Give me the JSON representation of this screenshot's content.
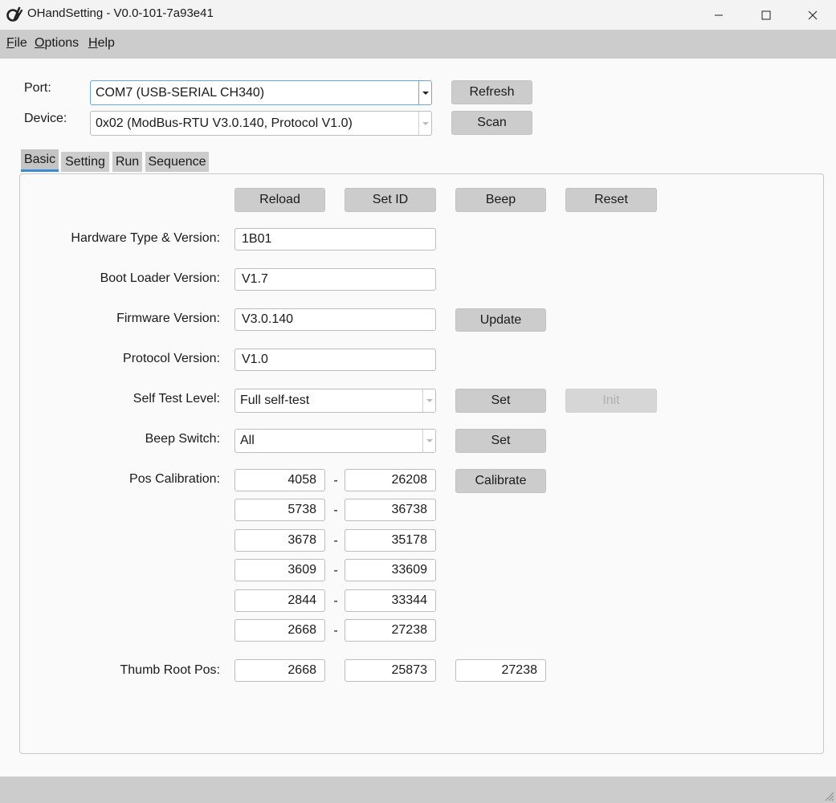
{
  "window": {
    "title": "OHandSetting - V0.0-101-7a93e41",
    "icon": "ohand-logo-icon"
  },
  "menu": [
    {
      "mnemonic": "F",
      "rest": "ile"
    },
    {
      "mnemonic": "O",
      "rest": "ptions"
    },
    {
      "mnemonic": "H",
      "rest": "elp"
    }
  ],
  "connection": {
    "port_label": "Port:",
    "port_value": "COM7 (USB-SERIAL CH340)",
    "device_label": "Device:",
    "device_value": "0x02 (ModBus-RTU V3.0.140, Protocol V1.0)",
    "refresh_label": "Refresh",
    "scan_label": "Scan"
  },
  "tabs": [
    "Basic",
    "Setting",
    "Run",
    "Sequence"
  ],
  "basic": {
    "actions": [
      "Reload",
      "Set ID",
      "Beep",
      "Reset"
    ],
    "hardware_label": "Hardware Type & Version:",
    "hardware_value": "1B01",
    "bootloader_label": "Boot Loader Version:",
    "bootloader_value": "V1.7",
    "firmware_label": "Firmware Version:",
    "firmware_value": "V3.0.140",
    "update_label": "Update",
    "protocol_label": "Protocol Version:",
    "protocol_value": "V1.0",
    "selftest_label": "Self Test Level:",
    "selftest_value": "Full self-test",
    "selftest_set_label": "Set",
    "init_label": "Init",
    "beep_switch_label": "Beep Switch:",
    "beep_switch_value": "All",
    "beep_set_label": "Set",
    "pos_cal_label": "Pos Calibration:",
    "calibrate_label": "Calibrate",
    "pos_cal": [
      {
        "min": "4058",
        "max": "26208"
      },
      {
        "min": "5738",
        "max": "36738"
      },
      {
        "min": "3678",
        "max": "35178"
      },
      {
        "min": "3609",
        "max": "33609"
      },
      {
        "min": "2844",
        "max": "33344"
      },
      {
        "min": "2668",
        "max": "27238"
      }
    ],
    "separator": "-",
    "thumb_root_label": "Thumb Root Pos:",
    "thumb_root": [
      "2668",
      "25873",
      "27238"
    ]
  }
}
